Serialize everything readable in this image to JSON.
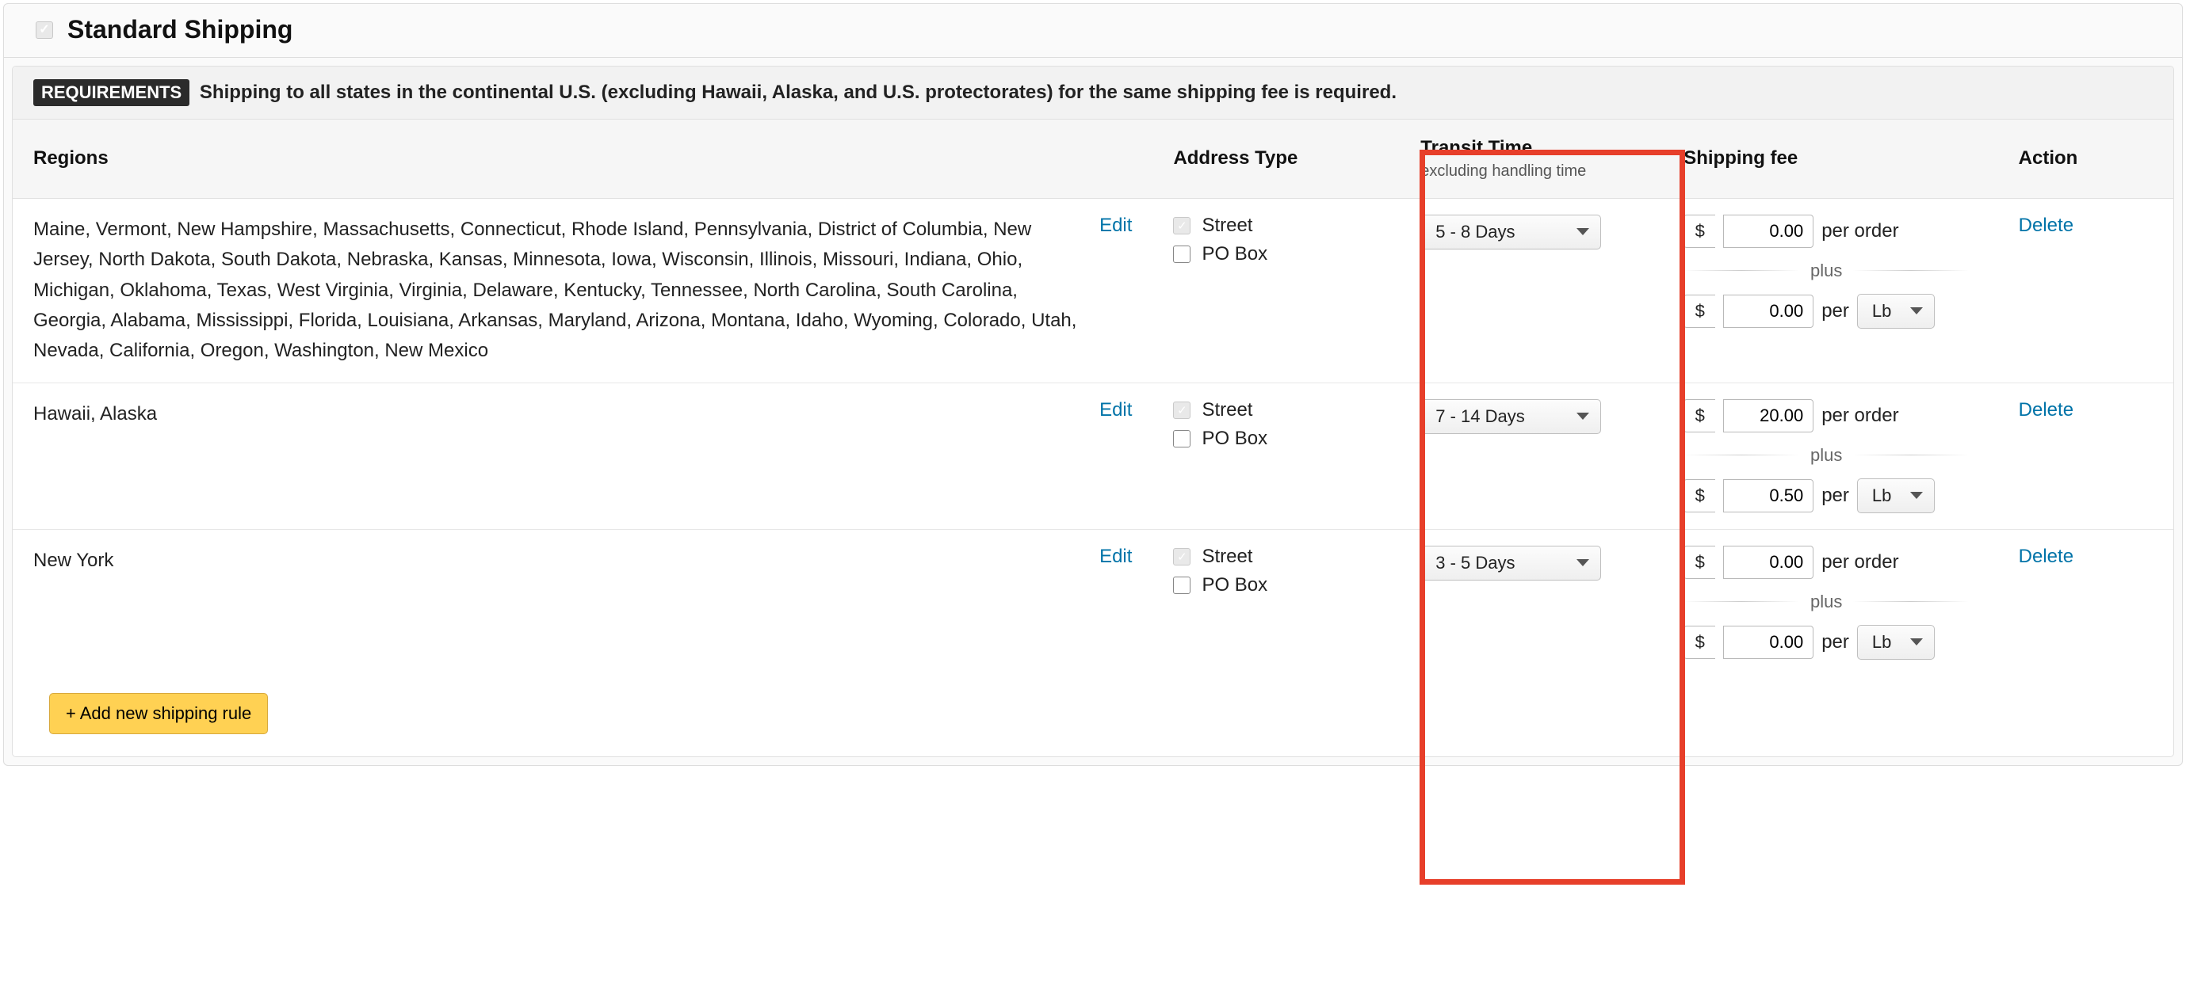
{
  "panel": {
    "title": "Standard Shipping",
    "title_checked": true
  },
  "requirements": {
    "badge": "REQUIREMENTS",
    "text": "Shipping to all states in the continental U.S. (excluding Hawaii, Alaska, and U.S. protectorates) for the same shipping fee is required."
  },
  "columns": {
    "regions": "Regions",
    "address_type": "Address Type",
    "transit_time": "Transit Time",
    "transit_time_sub": "excluding handling time",
    "shipping_fee": "Shipping fee",
    "action": "Action"
  },
  "labels": {
    "edit": "Edit",
    "delete": "Delete",
    "street": "Street",
    "po_box": "PO Box",
    "per_order": "per order",
    "per": "per",
    "weight_unit": "Lb",
    "plus": "plus",
    "currency": "$",
    "add_rule": "+ Add new shipping rule"
  },
  "rows": [
    {
      "regions": "Maine, Vermont, New Hampshire, Massachusetts, Connecticut, Rhode Island, Pennsylvania, District of Columbia, New Jersey, North Dakota, South Dakota, Nebraska, Kansas, Minnesota, Iowa, Wisconsin, Illinois, Missouri, Indiana, Ohio, Michigan, Oklahoma, Texas, West Virginia, Virginia, Delaware, Kentucky, Tennessee, North Carolina, South Carolina, Georgia, Alabama, Mississippi, Florida, Louisiana, Arkansas, Maryland, Arizona, Montana, Idaho, Wyoming, Colorado, Utah, Nevada, California, Oregon, Washington, New Mexico",
      "street_checked": true,
      "po_box_checked": false,
      "transit_time": "5 - 8 Days",
      "fee_per_order": "0.00",
      "fee_per_unit": "0.00"
    },
    {
      "regions": "Hawaii, Alaska",
      "street_checked": true,
      "po_box_checked": false,
      "transit_time": "7 - 14 Days",
      "fee_per_order": "20.00",
      "fee_per_unit": "0.50"
    },
    {
      "regions": "New York",
      "street_checked": true,
      "po_box_checked": false,
      "transit_time": "3 - 5 Days",
      "fee_per_order": "0.00",
      "fee_per_unit": "0.00"
    }
  ]
}
